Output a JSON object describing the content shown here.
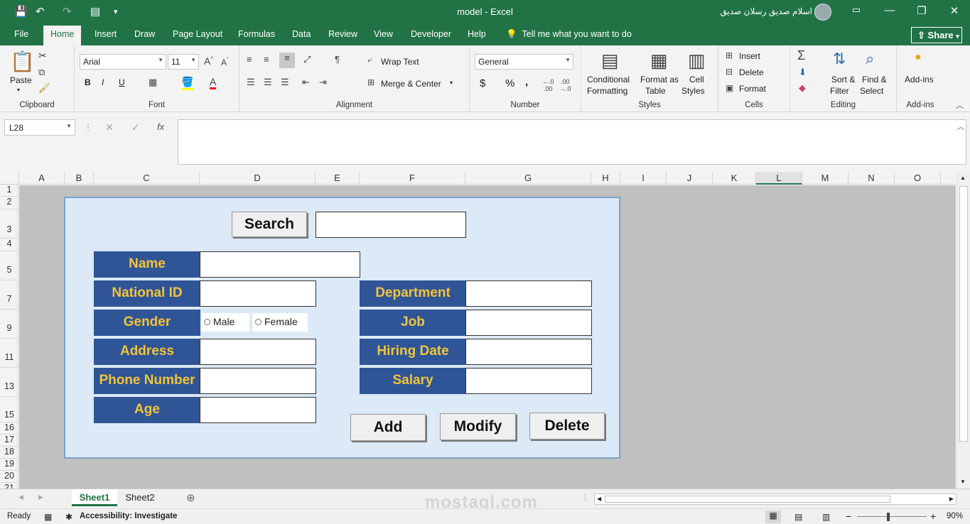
{
  "window": {
    "title": "model  -  Excel",
    "user_name": "اسلام صديق رسلان صديق",
    "minimize": "—",
    "restore": "❐",
    "close": "✕"
  },
  "quick_access": {
    "save": "💾",
    "undo": "↶",
    "redo": "↷",
    "form": "▤",
    "more": "▾"
  },
  "tabs": [
    {
      "label": "File"
    },
    {
      "label": "Home"
    },
    {
      "label": "Insert"
    },
    {
      "label": "Draw"
    },
    {
      "label": "Page Layout"
    },
    {
      "label": "Formulas"
    },
    {
      "label": "Data"
    },
    {
      "label": "Review"
    },
    {
      "label": "View"
    },
    {
      "label": "Developer"
    },
    {
      "label": "Help"
    }
  ],
  "tell_me": "Tell me what you want to do",
  "share": "Share",
  "ribbon": {
    "clipboard": {
      "label": "Clipboard",
      "paste": "Paste"
    },
    "font": {
      "label": "Font",
      "name": "Arial",
      "size": "11",
      "bold": "B",
      "italic": "I",
      "underline": "U"
    },
    "alignment": {
      "label": "Alignment",
      "wrap_text": "Wrap Text",
      "merge_center": "Merge & Center"
    },
    "number": {
      "label": "Number",
      "format": "General",
      "currency": "$",
      "percent": "%",
      "comma": ","
    },
    "styles": {
      "label": "Styles",
      "conditional_1": "Conditional",
      "conditional_2": "Formatting",
      "format_table_1": "Format as",
      "format_table_2": "Table",
      "cell_styles_1": "Cell",
      "cell_styles_2": "Styles"
    },
    "cells": {
      "label": "Cells",
      "insert": "Insert",
      "delete": "Delete",
      "format": "Format"
    },
    "editing": {
      "label": "Editing",
      "sort_1": "Sort &",
      "sort_2": "Filter",
      "find_1": "Find &",
      "find_2": "Select"
    },
    "addins": {
      "label": "Add-ins",
      "addins": "Add-ins"
    }
  },
  "formula_bar": {
    "name_box": "L28",
    "fx": "fx",
    "formula": ""
  },
  "columns": [
    "A",
    "B",
    "C",
    "D",
    "E",
    "F",
    "G",
    "H",
    "I",
    "J",
    "K",
    "L",
    "M",
    "N",
    "O"
  ],
  "selected_column": "L",
  "rows": [
    "1",
    "2",
    "3",
    "4",
    "5",
    "7",
    "9",
    "11",
    "13",
    "15",
    "16",
    "17",
    "18",
    "19",
    "20",
    "21"
  ],
  "form": {
    "search_button": "Search",
    "search_value": "",
    "left_fields": [
      {
        "label": "Name",
        "value": ""
      },
      {
        "label": "National ID",
        "value": ""
      },
      {
        "label": "Gender",
        "value": ""
      },
      {
        "label": "Address",
        "value": ""
      },
      {
        "label": "Phone Number",
        "value": ""
      },
      {
        "label": "Age",
        "value": ""
      }
    ],
    "gender_options": [
      "Male",
      "Female"
    ],
    "right_fields": [
      {
        "label": "Department",
        "value": ""
      },
      {
        "label": "Job",
        "value": ""
      },
      {
        "label": "Hiring Date",
        "value": ""
      },
      {
        "label": "Salary",
        "value": ""
      }
    ],
    "add_button": "Add",
    "modify_button": "Modify",
    "delete_button": "Delete"
  },
  "sheets": [
    "Sheet1",
    "Sheet2"
  ],
  "active_sheet": "Sheet1",
  "status": {
    "ready": "Ready",
    "accessibility": "Accessibility: Investigate",
    "zoom": "90%"
  },
  "watermark": "mostaql.com",
  "colors": {
    "excel_green": "#217346",
    "label_bg": "#2f5597",
    "label_text": "#f2c43a",
    "form_bg": "#dce9f6"
  }
}
